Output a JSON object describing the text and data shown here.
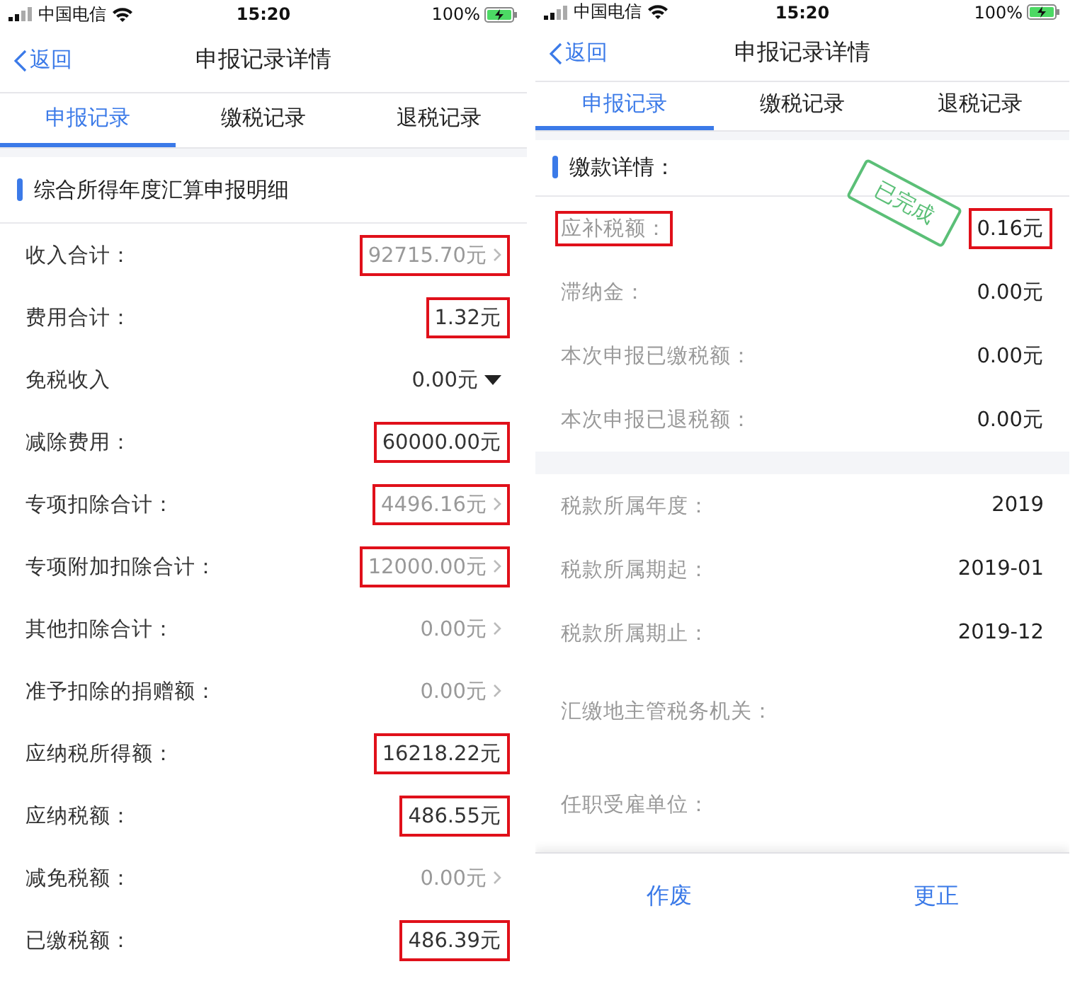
{
  "left": {
    "status_bar": {
      "carrier": "中国电信",
      "time": "15:20",
      "battery": "100%"
    },
    "nav": {
      "back": "返回",
      "title": "申报记录详情"
    },
    "tabs": [
      {
        "label": "申报记录",
        "selected": true
      },
      {
        "label": "缴税记录",
        "selected": false
      },
      {
        "label": "退税记录",
        "selected": false
      }
    ],
    "section_title": "综合所得年度汇算申报明细",
    "rows": [
      {
        "label": "收入合计：",
        "value": "92715.70元",
        "kind": "link",
        "highlighted": true
      },
      {
        "label": "费用合计：",
        "value": "1.32元",
        "kind": "plain",
        "highlighted": true
      },
      {
        "label": "免税收入",
        "value": "0.00元",
        "kind": "dropdown",
        "highlighted": false
      },
      {
        "label": "减除费用：",
        "value": "60000.00元",
        "kind": "plain",
        "highlighted": true
      },
      {
        "label": "专项扣除合计：",
        "value": "4496.16元",
        "kind": "link",
        "highlighted": true
      },
      {
        "label": "专项附加扣除合计：",
        "value": "12000.00元",
        "kind": "link",
        "highlighted": true
      },
      {
        "label": "其他扣除合计：",
        "value": "0.00元",
        "kind": "link",
        "highlighted": false
      },
      {
        "label": "准予扣除的捐赠额：",
        "value": "0.00元",
        "kind": "link",
        "highlighted": false
      },
      {
        "label": "应纳税所得额：",
        "value": "16218.22元",
        "kind": "plain",
        "highlighted": true
      },
      {
        "label": "应纳税额：",
        "value": "486.55元",
        "kind": "plain",
        "highlighted": true
      },
      {
        "label": "减免税额：",
        "value": "0.00元",
        "kind": "link",
        "highlighted": false
      },
      {
        "label": "已缴税额：",
        "value": "486.39元",
        "kind": "plain",
        "highlighted": true
      }
    ]
  },
  "right": {
    "status_bar": {
      "carrier": "中国电信",
      "time": "15:20",
      "battery": "100%"
    },
    "nav": {
      "back": "返回",
      "title": "申报记录详情"
    },
    "tabs": [
      {
        "label": "申报记录",
        "selected": true
      },
      {
        "label": "缴税记录",
        "selected": false
      },
      {
        "label": "退税记录",
        "selected": false
      }
    ],
    "section_title": "缴款详情：",
    "stamp": "已完成",
    "groups": [
      {
        "rows": [
          {
            "label": "应补税额：",
            "value": "0.16元",
            "highlighted": true
          },
          {
            "label": "滞纳金：",
            "value": "0.00元",
            "highlighted": false
          },
          {
            "label": "本次申报已缴税额：",
            "value": "0.00元",
            "highlighted": false
          },
          {
            "label": "本次申报已退税额：",
            "value": "0.00元",
            "highlighted": false
          }
        ]
      },
      {
        "rows": [
          {
            "label": "税款所属年度：",
            "value": "2019",
            "highlighted": false
          },
          {
            "label": "税款所属期起：",
            "value": "2019-01",
            "highlighted": false
          },
          {
            "label": "税款所属期止：",
            "value": "2019-12",
            "highlighted": false
          },
          {
            "label": "汇缴地主管税务机关：",
            "highlighted": false
          },
          {
            "label": "任职受雇单位：",
            "highlighted": false
          }
        ]
      }
    ],
    "buttons": [
      "作废",
      "更正"
    ]
  }
}
